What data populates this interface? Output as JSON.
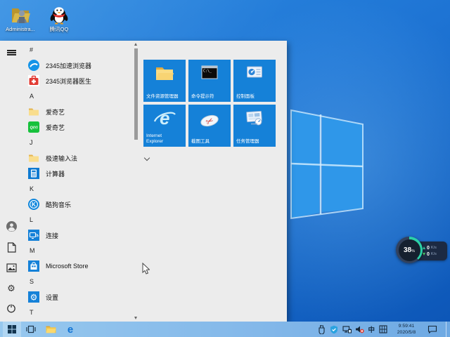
{
  "desktop": {
    "icons": [
      {
        "label": "Administra...",
        "icon": "user-folder-icon"
      },
      {
        "label": "腾讯QQ",
        "icon": "qq-penguin-icon"
      }
    ]
  },
  "start_menu": {
    "app_list": [
      {
        "type": "header",
        "label": "#"
      },
      {
        "type": "app",
        "label": "2345加速浏览器",
        "icon": "browser-2345-icon"
      },
      {
        "type": "app",
        "label": "2345浏览器医生",
        "icon": "firstaid-kit-icon"
      },
      {
        "type": "header",
        "label": "A"
      },
      {
        "type": "app",
        "label": "爱奇艺",
        "icon": "folder-icon",
        "expandable": true
      },
      {
        "type": "app",
        "label": "爱奇艺",
        "icon": "iqiyi-icon"
      },
      {
        "type": "header",
        "label": "J"
      },
      {
        "type": "app",
        "label": "极速输入法",
        "icon": "folder-icon",
        "expandable": true
      },
      {
        "type": "app",
        "label": "计算器",
        "icon": "calculator-icon"
      },
      {
        "type": "header",
        "label": "K"
      },
      {
        "type": "app",
        "label": "酷狗音乐",
        "icon": "kugou-music-icon"
      },
      {
        "type": "header",
        "label": "L"
      },
      {
        "type": "app",
        "label": "连接",
        "icon": "connect-icon"
      },
      {
        "type": "header",
        "label": "M"
      },
      {
        "type": "app",
        "label": "Microsoft Store",
        "icon": "store-icon"
      },
      {
        "type": "header",
        "label": "S"
      },
      {
        "type": "app",
        "label": "设置",
        "icon": "settings-icon"
      },
      {
        "type": "header",
        "label": "T"
      }
    ],
    "tiles": [
      {
        "label": "文件资源管理器",
        "icon": "file-explorer-icon"
      },
      {
        "label": "命令提示符",
        "icon": "command-prompt-icon"
      },
      {
        "label": "控制面板",
        "icon": "control-panel-icon"
      },
      {
        "label": "Internet Explorer",
        "label2": "Internet",
        "label3": "Explorer",
        "icon": "internet-explorer-icon"
      },
      {
        "label": "截图工具",
        "icon": "snipping-tool-icon"
      },
      {
        "label": "任务管理器",
        "icon": "task-manager-icon"
      }
    ]
  },
  "taskbar": {
    "tray": {
      "ime_lang": "中"
    },
    "clock": {
      "time": "9:59:41",
      "date": "2020/5/8"
    }
  },
  "net_widget": {
    "percent": "38",
    "percent_unit": "%",
    "up_value": "0",
    "up_unit": "K/s",
    "down_value": "0",
    "down_unit": "K/s"
  },
  "glyphs": {
    "ie_e": "e",
    "edge_e": "e",
    "kugou_k": "K",
    "iqiyi_mark": "QIYI",
    "cmd_prompt": "C:\\_",
    "scissors": "✂",
    "gear": "⚙"
  },
  "colors": {
    "tile_blue": "#1581d8",
    "accent_blue": "#0e7ad1",
    "taskbar_blue": "#85b9e9",
    "widget_ring_teal": "#2bd0a6",
    "menu_bg": "#ececec",
    "desktop_blue": "#1e74d4"
  }
}
